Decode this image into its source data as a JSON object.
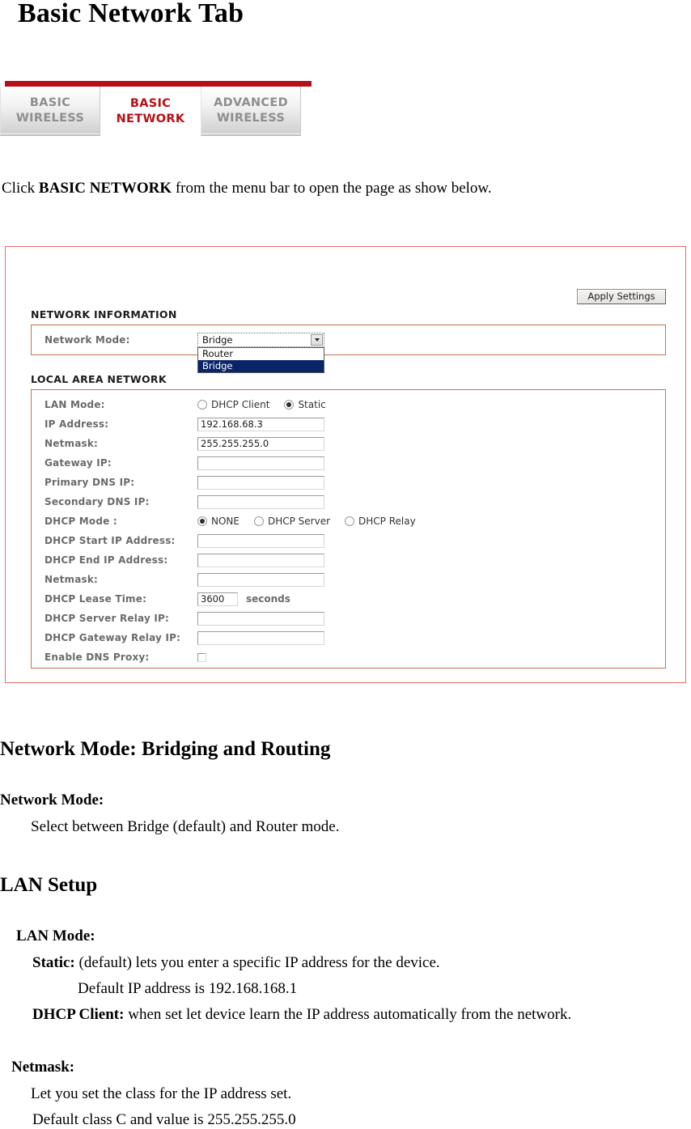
{
  "document": {
    "title": "Basic Network Tab",
    "intro_prefix": "Click ",
    "intro_bold": "BASIC NETWORK",
    "intro_suffix": " from the menu bar to open the page as show below."
  },
  "tabs": [
    {
      "line1": "BASIC",
      "line2": "WIRELESS",
      "active": false
    },
    {
      "line1": "BASIC",
      "line2": "NETWORK",
      "active": true
    },
    {
      "line1": "ADVANCED",
      "line2": "WIRELESS",
      "active": false
    }
  ],
  "screenshot": {
    "apply_button": "Apply Settings",
    "network_information": {
      "section_label": "NETWORK INFORMATION",
      "network_mode_label": "Network Mode:",
      "network_mode_value": "Bridge",
      "network_mode_options": [
        "Router",
        "Bridge"
      ],
      "network_mode_selected": "Bridge"
    },
    "local_area_network": {
      "section_label": "LOCAL AREA NETWORK",
      "lan_mode_label": "LAN Mode:",
      "lan_mode_options": [
        "DHCP Client",
        "Static"
      ],
      "lan_mode_selected": "Static",
      "ip_address_label": "IP Address:",
      "ip_address_value": "192.168.68.3",
      "netmask_label": "Netmask:",
      "netmask_value": "255.255.255.0",
      "gateway_ip_label": "Gateway IP:",
      "gateway_ip_value": "",
      "primary_dns_label": "Primary DNS IP:",
      "primary_dns_value": "",
      "secondary_dns_label": "Secondary DNS IP:",
      "secondary_dns_value": "",
      "dhcp_mode_label": "DHCP Mode :",
      "dhcp_mode_options": [
        "NONE",
        "DHCP Server",
        "DHCP Relay"
      ],
      "dhcp_mode_selected": "NONE",
      "dhcp_start_label": "DHCP Start IP Address:",
      "dhcp_start_value": "",
      "dhcp_end_label": "DHCP End IP Address:",
      "dhcp_end_value": "",
      "dhcp_netmask_label": "Netmask:",
      "dhcp_netmask_value": "",
      "lease_time_label": "DHCP Lease Time:",
      "lease_time_value": "3600",
      "lease_time_unit": "seconds",
      "server_relay_label": "DHCP Server Relay IP:",
      "server_relay_value": "",
      "gateway_relay_label": "DHCP Gateway Relay IP:",
      "gateway_relay_value": "",
      "dns_proxy_label": "Enable DNS Proxy:",
      "dns_proxy_checked": false
    }
  },
  "body": {
    "heading_network_mode": "Network Mode: Bridging and Routing",
    "sub_network_mode": "Network Mode:",
    "network_mode_desc": "Select between Bridge (default) and Router mode.",
    "heading_lan_setup": "LAN Setup",
    "sub_lan_mode": "LAN Mode:",
    "static_bold": "Static:",
    "static_rest": " (default) lets you enter a specific IP address for the device.",
    "static_default_ip": "Default IP address is 192.168.168.1",
    "dhcp_client_bold": "DHCP Client:",
    "dhcp_client_rest": " when set let device learn the IP address automatically from the network.",
    "sub_netmask": "Netmask:",
    "netmask_desc1": "Let you set the class for the IP address set.",
    "netmask_desc2": "Default class C and value is 255.255.255.0"
  },
  "colors": {
    "brand_red": "#b51015",
    "panel_border": "#e46b6b",
    "group_border": "#c4714f",
    "select_highlight": "#0a246a"
  }
}
